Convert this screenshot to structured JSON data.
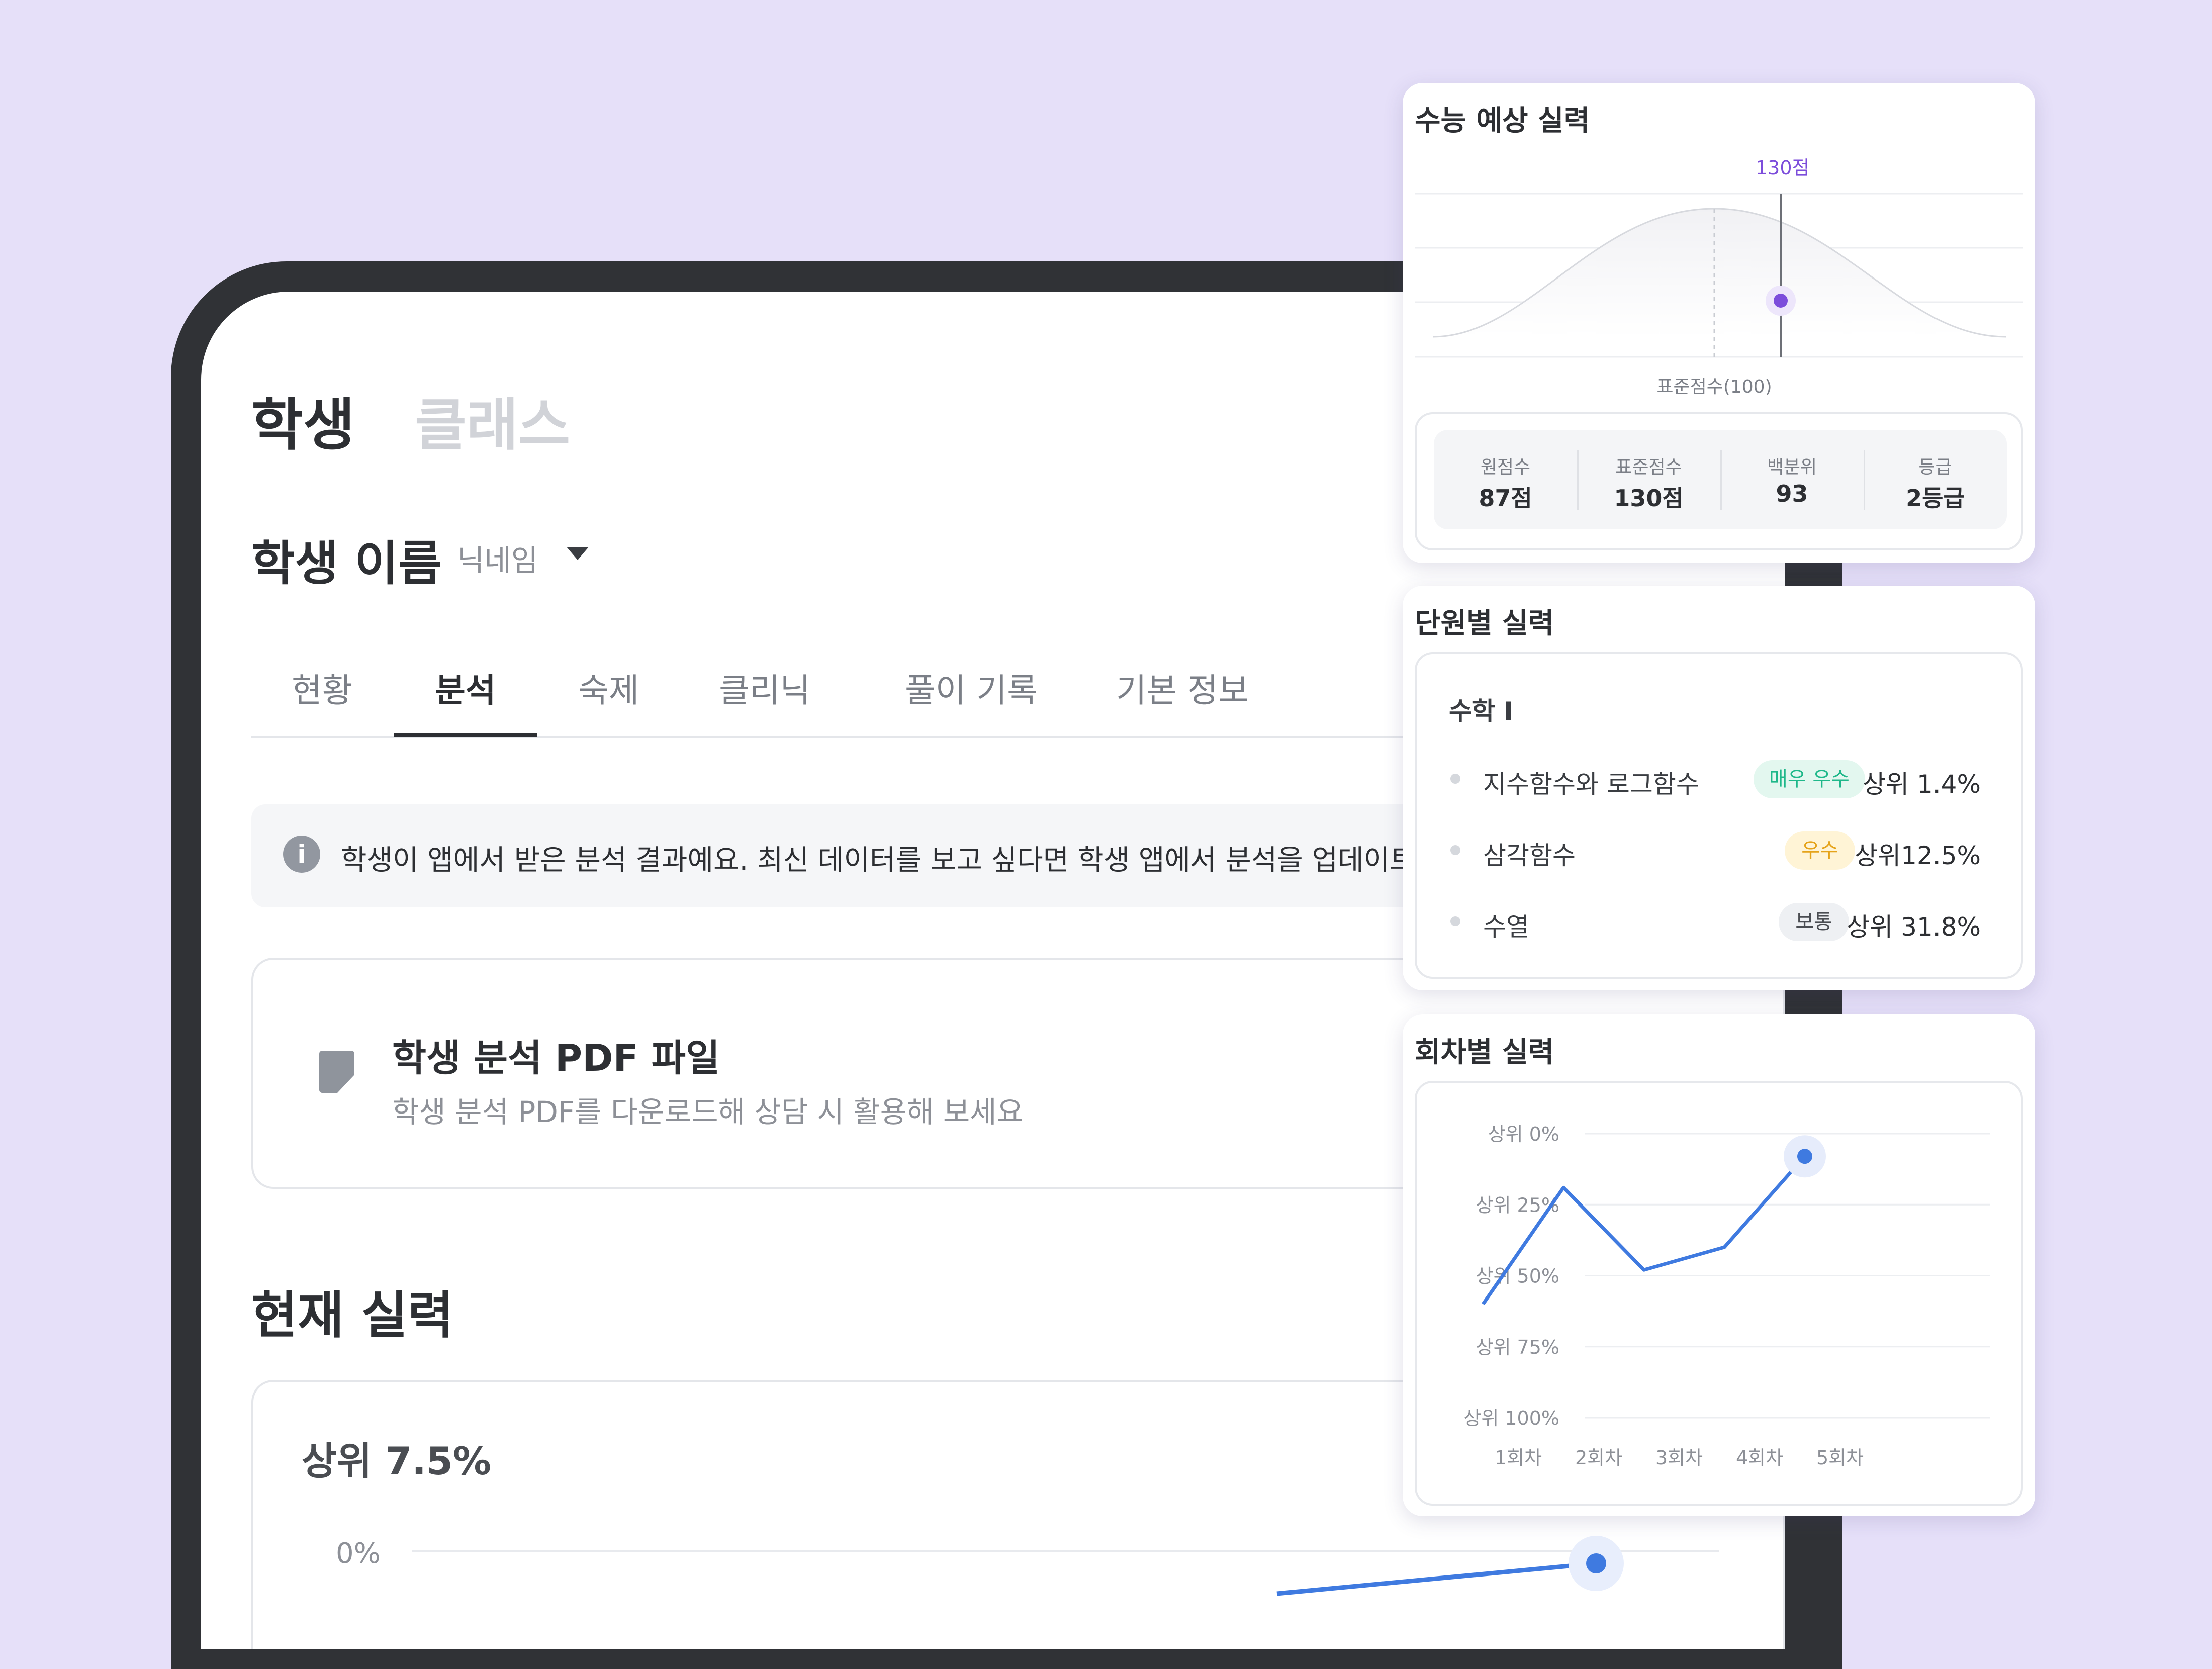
{
  "main_tabs": {
    "student": "학생",
    "class": "클래스"
  },
  "student": {
    "name": "학생 이름",
    "nickname": "닉네임"
  },
  "sub_tabs": [
    "현황",
    "분석",
    "숙제",
    "클리닉",
    "풀이 기록",
    "기본 정보"
  ],
  "active_sub_tab": "분석",
  "info_banner": {
    "text": "학생이 앱에서 받은 분석 결과예요. 최신 데이터를 보고 싶다면 학생 앱에서 분석을 업데이트",
    "icon": "info-icon"
  },
  "pdf_card": {
    "title": "학생 분석 PDF 파일",
    "subtitle": "학생 분석 PDF를 다운로드해 상담 시 활용해 보세요",
    "icon": "document-icon"
  },
  "current_skill": {
    "section_title": "현재 실력",
    "top_percent": "상위 7.5%",
    "y_tick_top": "0%",
    "line_color": "#3f7ae0"
  },
  "suneung_card": {
    "title": "수능 예상 실력",
    "marker_label": "130점",
    "axis_label": "표준점수(100)",
    "accent": "#7c4ddb",
    "stats": [
      {
        "label": "원점수",
        "value": "87점"
      },
      {
        "label": "표준점수",
        "value": "130점"
      },
      {
        "label": "백분위",
        "value": "93"
      },
      {
        "label": "등급",
        "value": "2등급"
      }
    ]
  },
  "unit_card": {
    "title": "단원별 실력",
    "subject": "수학 I",
    "units": [
      {
        "name": "지수함수와 로그함수",
        "badge": "매우 우수",
        "percent": "상위 1.4%",
        "badge_color": "#1fb88a",
        "badge_bg": "#e3f7ef"
      },
      {
        "name": "삼각함수",
        "badge": "우수",
        "percent": "상위12.5%",
        "badge_color": "#e5a31a",
        "badge_bg": "#fff4d6"
      },
      {
        "name": "수열",
        "badge": "보통",
        "percent": "상위 31.8%",
        "badge_color": "#4a4d52",
        "badge_bg": "#eef0f3"
      }
    ]
  },
  "round_card": {
    "title": "회차별 실력",
    "chart_data": {
      "type": "line",
      "x": [
        "1회차",
        "2회차",
        "3회차",
        "4회차",
        "5회차"
      ],
      "y_ticks": [
        "상위 0%",
        "상위 25%",
        "상위 50%",
        "상위 75%",
        "상위 100%"
      ],
      "ylim": [
        0,
        100
      ],
      "y_inverted": true,
      "series": [
        {
          "values": [
            60,
            19,
            48,
            40,
            8
          ]
        }
      ],
      "color": "#3f7ae0",
      "grid": true
    }
  }
}
